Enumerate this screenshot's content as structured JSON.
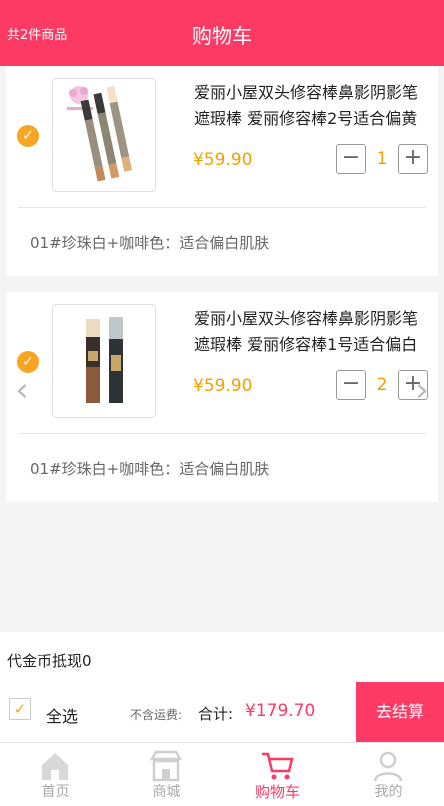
{
  "header": {
    "count_label": "共2件商品",
    "title": "购物车"
  },
  "cart": {
    "items": [
      {
        "name": "爱丽小屋双头修容棒鼻影阴影笔遮瑕棒 爱丽修容棒2号适合偏黄",
        "price": "¥59.90",
        "qty": "1",
        "spec": "01#珍珠白+咖啡色：适合偏白肌肤",
        "checked_icon": "✓"
      },
      {
        "name": "爱丽小屋双头修容棒鼻影阴影笔遮瑕棒 爱丽修容棒1号适合偏白",
        "price": "¥59.90",
        "qty": "2",
        "spec": "01#珍珠白+咖啡色：适合偏白肌肤",
        "checked_icon": "✓"
      }
    ],
    "qty_minus": "−",
    "qty_plus": "+"
  },
  "arrows": {
    "left": "‹",
    "right": "›"
  },
  "coin": {
    "label": "代金币抵现0"
  },
  "footer": {
    "select_all_icon": "✓",
    "select_all": "全选",
    "freight_note": "不含运费:",
    "total_label": "合计:",
    "total_value": "¥179.70",
    "checkout": "去结算"
  },
  "tabs": [
    {
      "label": "首页",
      "icon": "home-icon"
    },
    {
      "label": "商城",
      "icon": "shop-icon"
    },
    {
      "label": "购物车",
      "icon": "cart-icon"
    },
    {
      "label": "我的",
      "icon": "user-icon"
    }
  ],
  "colors": {
    "brand": "#fc3a63",
    "price": "#f0a000",
    "check": "#f6a623"
  }
}
